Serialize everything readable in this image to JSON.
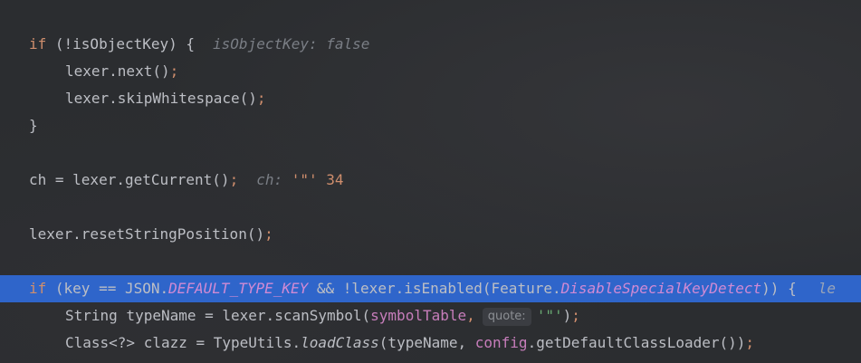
{
  "code": {
    "line1": {
      "kw": "if",
      "text": " (!isObjectKey) {",
      "hint_label": "isObjectKey: ",
      "hint_value": "false"
    },
    "line2": {
      "text": "lexer.next()",
      "semi": ";"
    },
    "line3": {
      "text": "lexer.skipWhitespace()",
      "semi": ";"
    },
    "line4": {
      "text": "}"
    },
    "line5": {
      "text": "ch = lexer.getCurrent()",
      "semi": ";",
      "hint_label": "ch: ",
      "hint_value": "'\"'",
      "hint_num": "34"
    },
    "line6": {
      "text": "lexer.resetStringPosition()",
      "semi": ";"
    },
    "line7": {
      "kw": "if",
      "part1": " (key == JSON.",
      "field1": "DEFAULT_TYPE_KEY",
      "part2": " && !lexer.isEnabled(Feature.",
      "field2": "DisableSpecialKeyDetect",
      "part3": ")) {",
      "cut_hint": "le"
    },
    "line8": {
      "part1": "String typeName = lexer.scanSymbol(",
      "field": "symbolTable",
      "comma": ",",
      "param_hint": "quote:",
      "string": "'\"'",
      "part2": ")",
      "semi": ";"
    },
    "line9": {
      "part1": "Class<?> clazz = TypeUtils.",
      "static_method": "loadClass",
      "part2": "(typeName, ",
      "field": "config",
      "part3": ".getDefaultClassLoader())",
      "semi": ";"
    }
  }
}
